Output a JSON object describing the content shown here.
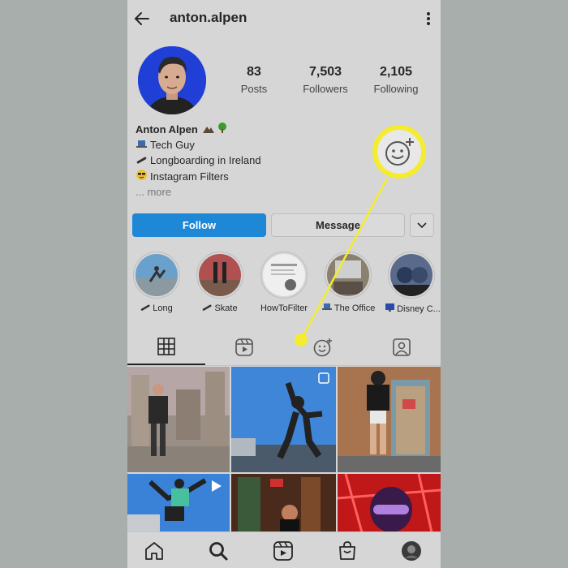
{
  "profile": {
    "username": "anton.alpen",
    "stats": [
      {
        "value": "83",
        "label": "Posts"
      },
      {
        "value": "7,503",
        "label": "Followers"
      },
      {
        "value": "2,105",
        "label": "Following"
      }
    ],
    "bio": {
      "name": "Anton Alpen",
      "lines": [
        "Tech Guy",
        "Longboarding in Ireland",
        "Instagram Filters"
      ],
      "more": "... more"
    }
  },
  "actions": {
    "follow_label": "Follow",
    "message_label": "Message"
  },
  "highlights": [
    "Long",
    "Skate",
    "HowToFilter",
    "The Office",
    "Disney C..."
  ],
  "tabs": [
    "grid",
    "reels",
    "effects",
    "tagged"
  ],
  "nav": [
    "home",
    "search",
    "reels",
    "shop",
    "profile"
  ],
  "colors": {
    "follow_blue": "#1e88d6",
    "callout_yellow": "#f3ec2f",
    "avatar_blue": "#1f3fd6"
  }
}
